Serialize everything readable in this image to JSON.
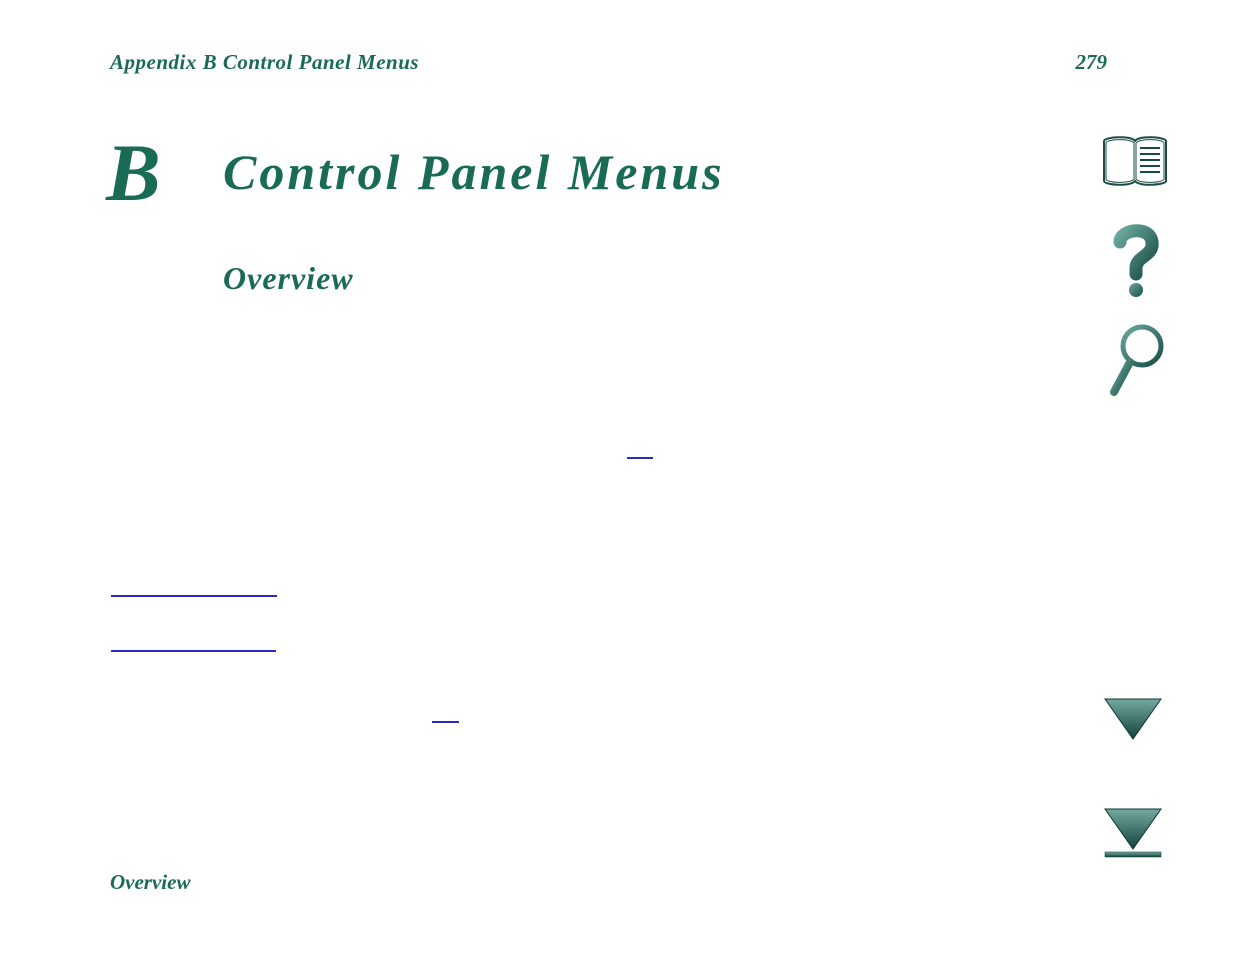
{
  "header": {
    "left": "Appendix B   Control Panel Menus",
    "page_number": "279"
  },
  "appendix_letter": "B",
  "title": "Control Panel Menus",
  "section_heading": "Overview",
  "footer": "Overview",
  "icons": {
    "book": "book-icon",
    "question": "question-icon",
    "search": "search-icon",
    "down": "chevron-down-icon",
    "end": "go-to-end-icon"
  },
  "colors": {
    "brand": "#1a6b55",
    "link_underline": "#2a2ac8",
    "icon_fill": "#2e6a62",
    "icon_shadow": "#0e3d38"
  }
}
